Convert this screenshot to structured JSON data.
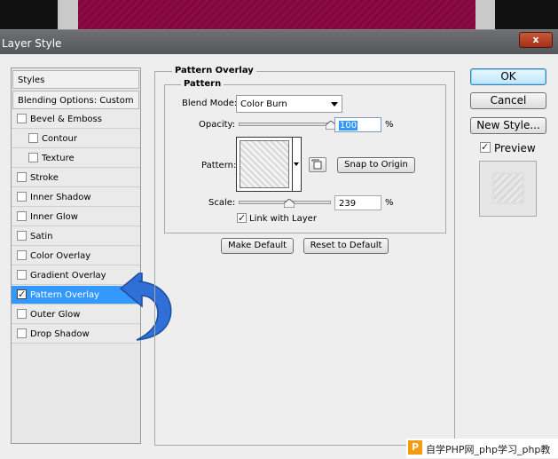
{
  "window": {
    "title": "Layer Style",
    "close_glyph": "x"
  },
  "styles_list": {
    "header": "Styles",
    "blending": "Blending Options: Custom",
    "items": [
      {
        "label": "Bevel & Emboss",
        "checked": false
      },
      {
        "label": "Contour",
        "checked": false
      },
      {
        "label": "Texture",
        "checked": false
      },
      {
        "label": "Stroke",
        "checked": false
      },
      {
        "label": "Inner Shadow",
        "checked": false
      },
      {
        "label": "Inner Glow",
        "checked": false
      },
      {
        "label": "Satin",
        "checked": false
      },
      {
        "label": "Color Overlay",
        "checked": false
      },
      {
        "label": "Gradient Overlay",
        "checked": false
      },
      {
        "label": "Pattern Overlay",
        "checked": true,
        "selected": true
      },
      {
        "label": "Outer Glow",
        "checked": false
      },
      {
        "label": "Drop Shadow",
        "checked": false
      }
    ]
  },
  "panel": {
    "group_title": "Pattern Overlay",
    "subgroup_title": "Pattern",
    "blend_mode_label": "Blend Mode:",
    "blend_mode_value": "Color Burn",
    "opacity_label": "Opacity:",
    "opacity_value": "100",
    "opacity_unit": "%",
    "opacity_level": 1.0,
    "pattern_label": "Pattern:",
    "snap_button": "Snap to Origin",
    "scale_label": "Scale:",
    "scale_value": "239",
    "scale_unit": "%",
    "scale_level": 0.239,
    "link_label": "Link with Layer",
    "link_checked": true,
    "make_default": "Make Default",
    "reset_default": "Reset to Default"
  },
  "actions": {
    "ok": "OK",
    "cancel": "Cancel",
    "new_style": "New Style...",
    "preview_label": "Preview",
    "preview_checked": true
  },
  "watermark": {
    "badge": "P",
    "text": "自学PHP网_php学习_php教"
  },
  "colors": {
    "selection": "#3399ff",
    "arrow": "#2f6fd6",
    "background_pattern": "#8e0a45"
  }
}
